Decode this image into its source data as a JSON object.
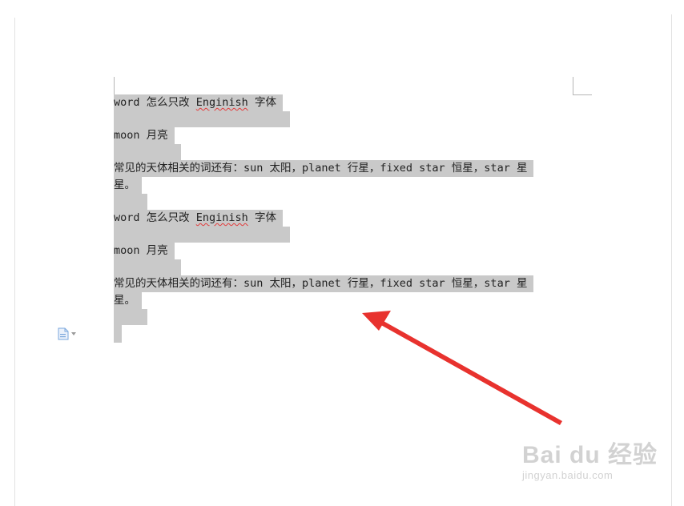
{
  "document": {
    "block1": {
      "line1": {
        "pre": "word 怎么只改 ",
        "spell": "Enginish",
        "post": " 字体"
      },
      "line2": "moon 月亮",
      "line3a": "常见的天体相关的词还有：sun 太阳，planet 行星，fixed star 恒星，star 星",
      "line3b": "星。"
    },
    "block2": {
      "line1": {
        "pre": "word 怎么只改 ",
        "spell": "Enginish",
        "post": " 字体"
      },
      "line2": "moon 月亮",
      "line3a": "常见的天体相关的词还有：sun 太阳，planet 行星，fixed star 恒星，star 星",
      "line3b": "星。"
    }
  },
  "icons": {
    "paste_options": "paste-options-icon"
  },
  "watermark": {
    "main": "Bai du 经验",
    "sub": "jingyan.baidu.com"
  },
  "colors": {
    "selection": "#c9c9c9",
    "arrow": "#e8322e",
    "spellcheck": "#e23b3b"
  }
}
